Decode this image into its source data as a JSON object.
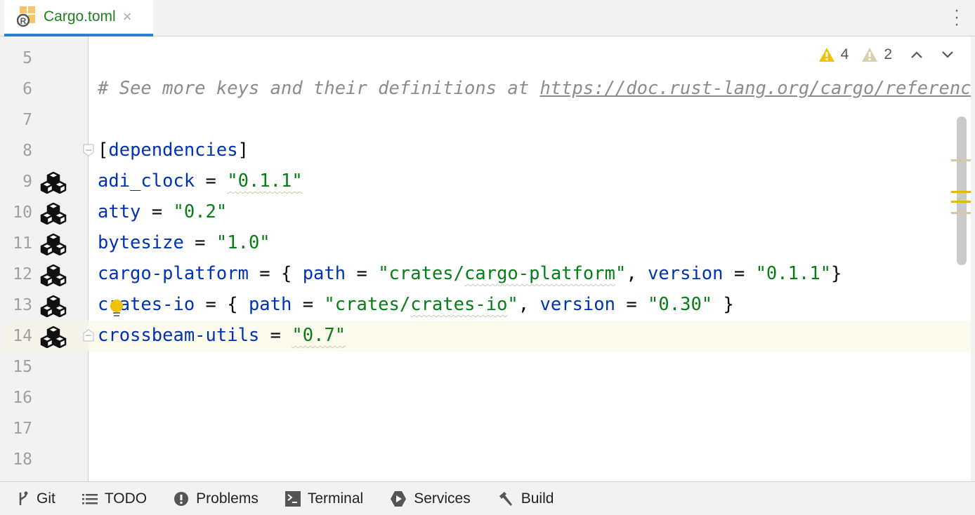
{
  "tab": {
    "filename": "Cargo.toml",
    "close": "×"
  },
  "inspections": {
    "warnings": "4",
    "weak_warnings": "2"
  },
  "lines": [
    {
      "n": "5",
      "tokens": []
    },
    {
      "n": "6",
      "tokens": [
        {
          "t": "# See more keys and their definitions at ",
          "c": "c"
        },
        {
          "t": "https://doc.rust-lang.org/cargo/reference/manifest.html",
          "c": "u"
        }
      ]
    },
    {
      "n": "7",
      "tokens": []
    },
    {
      "n": "8",
      "fold": "open",
      "tokens": [
        {
          "t": "[",
          "c": ""
        },
        {
          "t": "dependencies",
          "c": "k"
        },
        {
          "t": "]",
          "c": ""
        }
      ]
    },
    {
      "n": "9",
      "crate": true,
      "tokens": [
        {
          "t": "adi_clock",
          "c": "k"
        },
        {
          "t": " = ",
          "c": ""
        },
        {
          "t": "\"0.1.1\"",
          "c": "s w"
        }
      ]
    },
    {
      "n": "10",
      "crate": true,
      "tokens": [
        {
          "t": "atty",
          "c": "k"
        },
        {
          "t": " = ",
          "c": ""
        },
        {
          "t": "\"0.2\"",
          "c": "s"
        }
      ]
    },
    {
      "n": "11",
      "crate": true,
      "tokens": [
        {
          "t": "bytesize",
          "c": "k"
        },
        {
          "t": " = ",
          "c": ""
        },
        {
          "t": "\"1.0\"",
          "c": "s"
        }
      ]
    },
    {
      "n": "12",
      "crate": true,
      "tokens": [
        {
          "t": "cargo-platform",
          "c": "k"
        },
        {
          "t": " = { ",
          "c": ""
        },
        {
          "t": "path",
          "c": "k"
        },
        {
          "t": " = ",
          "c": ""
        },
        {
          "t": "\"crates/",
          "c": "s"
        },
        {
          "t": "cargo-platform",
          "c": "s w"
        },
        {
          "t": "\"",
          "c": "s"
        },
        {
          "t": ", ",
          "c": ""
        },
        {
          "t": "version",
          "c": "k"
        },
        {
          "t": " = ",
          "c": ""
        },
        {
          "t": "\"0.1.1\"",
          "c": "s"
        },
        {
          "t": "}",
          "c": ""
        }
      ]
    },
    {
      "n": "13",
      "crate": true,
      "tokens": [
        {
          "t": "crates-io",
          "c": "k"
        },
        {
          "t": " = { ",
          "c": ""
        },
        {
          "t": "path",
          "c": "k"
        },
        {
          "t": " = ",
          "c": ""
        },
        {
          "t": "\"crates/",
          "c": "s"
        },
        {
          "t": "crates-io",
          "c": "s w"
        },
        {
          "t": "\"",
          "c": "s"
        },
        {
          "t": ", ",
          "c": ""
        },
        {
          "t": "version",
          "c": "k"
        },
        {
          "t": " = ",
          "c": ""
        },
        {
          "t": "\"0.30\"",
          "c": "s"
        },
        {
          "t": " }",
          "c": ""
        }
      ]
    },
    {
      "n": "14",
      "crate": true,
      "fold": "close",
      "current": true,
      "tokens": [
        {
          "t": "crossbeam-utils",
          "c": "k"
        },
        {
          "t": " = ",
          "c": ""
        },
        {
          "t": "\"0.7\"",
          "c": "s w"
        }
      ]
    },
    {
      "n": "15",
      "tokens": []
    },
    {
      "n": "16",
      "tokens": []
    },
    {
      "n": "17",
      "tokens": []
    },
    {
      "n": "18",
      "tokens": []
    }
  ],
  "toolwindows": [
    {
      "label": "Git",
      "icon": "git-branch-icon"
    },
    {
      "label": "TODO",
      "icon": "list-icon"
    },
    {
      "label": "Problems",
      "icon": "problems-icon"
    },
    {
      "label": "Terminal",
      "icon": "terminal-icon"
    },
    {
      "label": "Services",
      "icon": "services-icon"
    },
    {
      "label": "Build",
      "icon": "hammer-icon"
    }
  ],
  "colors": {
    "warning": "#f2c200",
    "weak_warning": "#d9cfae",
    "accent": "#2a7fd0"
  }
}
